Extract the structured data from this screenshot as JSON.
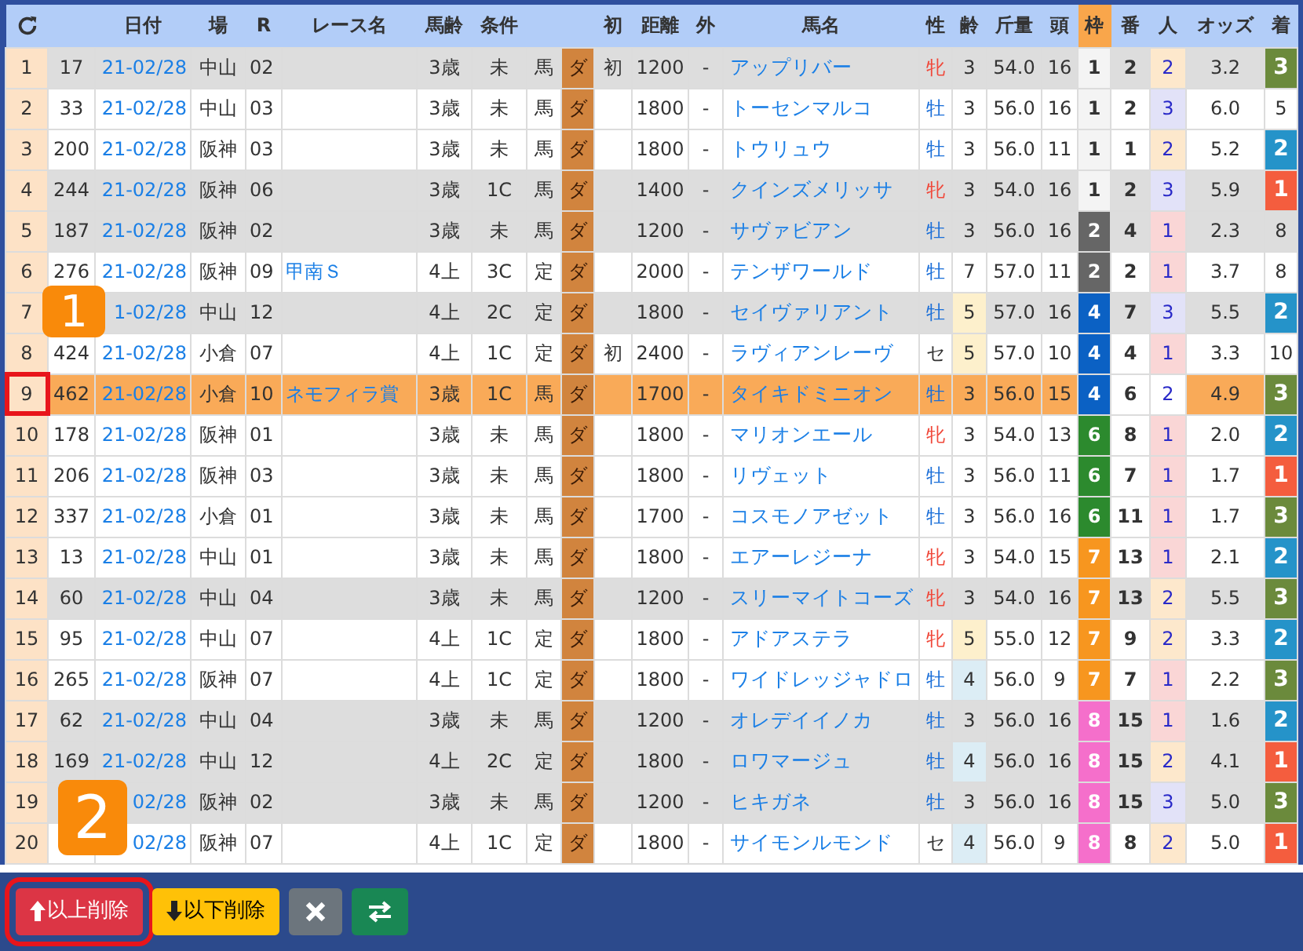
{
  "columns": [
    {
      "kind": "reload"
    },
    {},
    {
      "label": "日付"
    },
    {
      "label": "場"
    },
    {
      "label": "R"
    },
    {
      "label": "レース名"
    },
    {
      "label": "馬齢"
    },
    {
      "label": "条件"
    },
    {},
    {},
    {
      "label": "初"
    },
    {
      "label": "距離"
    },
    {
      "label": "外"
    },
    {
      "label": "馬名"
    },
    {
      "label": "性"
    },
    {
      "label": "齢"
    },
    {
      "label": "斤量"
    },
    {
      "label": "頭"
    },
    {
      "label": "枠",
      "kind": "accent"
    },
    {
      "label": "番"
    },
    {
      "label": "人"
    },
    {
      "label": "オッズ"
    },
    {
      "label": "着"
    }
  ],
  "rows": [
    {
      "index": "1",
      "number": "17",
      "date": "21-02/28",
      "course": "中山",
      "race": "02",
      "age_class": "3歳",
      "condition": "未",
      "rule": "馬",
      "surface": "ダ",
      "first": "初",
      "distance": "1200",
      "outside": "-",
      "horse": "アップリバー",
      "sex": {
        "text": "牝",
        "kind": "female"
      },
      "age": {
        "text": "3"
      },
      "weight": "54.0",
      "runners": "16",
      "waku": {
        "text": "1",
        "color": "#f4f4f4"
      },
      "umaban": "2",
      "popularity": {
        "text": "2",
        "color": "#fde8cc"
      },
      "odds": "3.2",
      "finish": {
        "text": "3",
        "color": "#6b8a3c"
      },
      "shaded": true,
      "selected": false,
      "highlighted": false
    },
    {
      "index": "2",
      "number": "33",
      "date": "21-02/28",
      "course": "中山",
      "race": "03",
      "age_class": "3歳",
      "condition": "未",
      "rule": "馬",
      "surface": "ダ",
      "distance": "1800",
      "outside": "-",
      "horse": "トーセンマルコ",
      "sex": {
        "text": "牡",
        "kind": "male"
      },
      "age": {
        "text": "3"
      },
      "weight": "56.0",
      "runners": "16",
      "waku": {
        "text": "1",
        "color": "#f4f4f4"
      },
      "umaban": "2",
      "popularity": {
        "text": "3",
        "color": "#e2e2f8"
      },
      "odds": "6.0",
      "finish": {
        "text": "5"
      },
      "shaded": false,
      "selected": false,
      "highlighted": false
    },
    {
      "index": "3",
      "number": "200",
      "date": "21-02/28",
      "course": "阪神",
      "race": "03",
      "age_class": "3歳",
      "condition": "未",
      "rule": "馬",
      "surface": "ダ",
      "distance": "1800",
      "outside": "-",
      "horse": "トウリュウ",
      "sex": {
        "text": "牡",
        "kind": "male"
      },
      "age": {
        "text": "3"
      },
      "weight": "56.0",
      "runners": "11",
      "waku": {
        "text": "1",
        "color": "#f4f4f4"
      },
      "umaban": "1",
      "popularity": {
        "text": "2",
        "color": "#fde8cc"
      },
      "odds": "5.2",
      "finish": {
        "text": "2",
        "color": "#2593c9"
      },
      "shaded": false,
      "selected": false,
      "highlighted": false
    },
    {
      "index": "4",
      "number": "244",
      "date": "21-02/28",
      "course": "阪神",
      "race": "06",
      "age_class": "3歳",
      "condition": "1C",
      "rule": "馬",
      "surface": "ダ",
      "distance": "1400",
      "outside": "-",
      "horse": "クインズメリッサ",
      "sex": {
        "text": "牝",
        "kind": "female"
      },
      "age": {
        "text": "3"
      },
      "weight": "54.0",
      "runners": "16",
      "waku": {
        "text": "1",
        "color": "#f4f4f4"
      },
      "umaban": "2",
      "popularity": {
        "text": "3",
        "color": "#e2e2f8"
      },
      "odds": "5.9",
      "finish": {
        "text": "1",
        "color": "#f45d3e"
      },
      "shaded": true,
      "selected": false,
      "highlighted": false
    },
    {
      "index": "5",
      "number": "187",
      "date": "21-02/28",
      "course": "阪神",
      "race": "02",
      "age_class": "3歳",
      "condition": "未",
      "rule": "馬",
      "surface": "ダ",
      "distance": "1200",
      "outside": "-",
      "horse": "サヴァビアン",
      "sex": {
        "text": "牡",
        "kind": "male"
      },
      "age": {
        "text": "3"
      },
      "weight": "56.0",
      "runners": "16",
      "waku": {
        "text": "2",
        "color": "#666666"
      },
      "umaban": "4",
      "popularity": {
        "text": "1",
        "color": "#fad6d6"
      },
      "odds": "2.3",
      "finish": {
        "text": "8"
      },
      "shaded": true,
      "selected": false,
      "highlighted": false
    },
    {
      "index": "6",
      "number": "276",
      "date": "21-02/28",
      "course": "阪神",
      "race": "09",
      "race_name": "甲南Ｓ",
      "age_class": "4上",
      "condition": "3C",
      "rule": "定",
      "surface": "ダ",
      "distance": "2000",
      "outside": "-",
      "horse": "テンザワールド",
      "sex": {
        "text": "牡",
        "kind": "male"
      },
      "age": {
        "text": "7"
      },
      "weight": "57.0",
      "runners": "11",
      "waku": {
        "text": "2",
        "color": "#666666"
      },
      "umaban": "2",
      "popularity": {
        "text": "1",
        "color": "#fad6d6"
      },
      "odds": "3.7",
      "finish": {
        "text": "8"
      },
      "shaded": false,
      "selected": false,
      "highlighted": false
    },
    {
      "index": "7",
      "date": "1-02/28",
      "course": "中山",
      "race": "12",
      "age_class": "4上",
      "condition": "2C",
      "rule": "定",
      "surface": "ダ",
      "distance": "1800",
      "outside": "-",
      "horse": "セイヴァリアント",
      "sex": {
        "text": "牡",
        "kind": "male"
      },
      "age": {
        "text": "5",
        "color": "#fdf0cc"
      },
      "weight": "57.0",
      "runners": "16",
      "waku": {
        "text": "4",
        "color": "#0b61c4"
      },
      "umaban": "7",
      "popularity": {
        "text": "3",
        "color": "#e2e2f8"
      },
      "odds": "5.5",
      "finish": {
        "text": "2",
        "color": "#2593c9"
      },
      "shaded": true,
      "selected": false,
      "highlighted": false
    },
    {
      "index": "8",
      "number": "424",
      "date": "21-02/28",
      "course": "小倉",
      "race": "07",
      "age_class": "4上",
      "condition": "1C",
      "rule": "定",
      "surface": "ダ",
      "first": "初",
      "distance": "2400",
      "outside": "-",
      "horse": "ラヴィアンレーヴ",
      "sex": {
        "text": "セ",
        "kind": "gelding"
      },
      "age": {
        "text": "5",
        "color": "#fdf0cc"
      },
      "weight": "57.0",
      "runners": "10",
      "waku": {
        "text": "4",
        "color": "#0b61c4"
      },
      "umaban": "4",
      "popularity": {
        "text": "1",
        "color": "#fad6d6"
      },
      "odds": "3.3",
      "finish": {
        "text": "10"
      },
      "shaded": false,
      "selected": false,
      "highlighted": false
    },
    {
      "index": "9",
      "number": "462",
      "date": "21-02/28",
      "course": "小倉",
      "race": "10",
      "race_name": "ネモフィラ賞",
      "age_class": "3歳",
      "condition": "1C",
      "rule": "馬",
      "surface": "ダ",
      "distance": "1700",
      "outside": "-",
      "horse": "タイキドミニオン",
      "sex": {
        "text": "牡",
        "kind": "male"
      },
      "age": {
        "text": "3"
      },
      "weight": "56.0",
      "runners": "15",
      "waku": {
        "text": "4",
        "color": "#0b61c4"
      },
      "umaban": "6",
      "popularity": {
        "text": "2"
      },
      "odds": "4.9",
      "finish": {
        "text": "3",
        "color": "#6b8a3c"
      },
      "selected": true,
      "highlighted": true
    },
    {
      "index": "10",
      "number": "178",
      "date": "21-02/28",
      "course": "阪神",
      "race": "01",
      "age_class": "3歳",
      "condition": "未",
      "rule": "馬",
      "surface": "ダ",
      "distance": "1800",
      "outside": "-",
      "horse": "マリオンエール",
      "sex": {
        "text": "牝",
        "kind": "female"
      },
      "age": {
        "text": "3"
      },
      "weight": "54.0",
      "runners": "13",
      "waku": {
        "text": "6",
        "color": "#2c8a2e"
      },
      "umaban": "8",
      "popularity": {
        "text": "1",
        "color": "#fad6d6"
      },
      "odds": "2.0",
      "finish": {
        "text": "2",
        "color": "#2593c9"
      },
      "shaded": false,
      "selected": false,
      "highlighted": false
    },
    {
      "index": "11",
      "number": "206",
      "date": "21-02/28",
      "course": "阪神",
      "race": "03",
      "age_class": "3歳",
      "condition": "未",
      "rule": "馬",
      "surface": "ダ",
      "distance": "1800",
      "outside": "-",
      "horse": "リヴェット",
      "sex": {
        "text": "牡",
        "kind": "male"
      },
      "age": {
        "text": "3"
      },
      "weight": "56.0",
      "runners": "11",
      "waku": {
        "text": "6",
        "color": "#2c8a2e"
      },
      "umaban": "7",
      "popularity": {
        "text": "1",
        "color": "#fad6d6"
      },
      "odds": "1.7",
      "finish": {
        "text": "1",
        "color": "#f45d3e"
      },
      "shaded": false,
      "selected": false,
      "highlighted": false
    },
    {
      "index": "12",
      "number": "337",
      "date": "21-02/28",
      "course": "小倉",
      "race": "01",
      "age_class": "3歳",
      "condition": "未",
      "rule": "馬",
      "surface": "ダ",
      "distance": "1700",
      "outside": "-",
      "horse": "コスモノアゼット",
      "sex": {
        "text": "牡",
        "kind": "male"
      },
      "age": {
        "text": "3"
      },
      "weight": "56.0",
      "runners": "16",
      "waku": {
        "text": "6",
        "color": "#2c8a2e"
      },
      "umaban": "11",
      "popularity": {
        "text": "1",
        "color": "#fad6d6"
      },
      "odds": "1.7",
      "finish": {
        "text": "3",
        "color": "#6b8a3c"
      },
      "shaded": false,
      "selected": false,
      "highlighted": false
    },
    {
      "index": "13",
      "number": "13",
      "date": "21-02/28",
      "course": "中山",
      "race": "01",
      "age_class": "3歳",
      "condition": "未",
      "rule": "馬",
      "surface": "ダ",
      "distance": "1800",
      "outside": "-",
      "horse": "エアーレジーナ",
      "sex": {
        "text": "牝",
        "kind": "female"
      },
      "age": {
        "text": "3"
      },
      "weight": "54.0",
      "runners": "15",
      "waku": {
        "text": "7",
        "color": "#f7961f"
      },
      "umaban": "13",
      "popularity": {
        "text": "1",
        "color": "#fad6d6"
      },
      "odds": "2.1",
      "finish": {
        "text": "2",
        "color": "#2593c9"
      },
      "shaded": false,
      "selected": false,
      "highlighted": false
    },
    {
      "index": "14",
      "number": "60",
      "date": "21-02/28",
      "course": "中山",
      "race": "04",
      "age_class": "3歳",
      "condition": "未",
      "rule": "馬",
      "surface": "ダ",
      "distance": "1200",
      "outside": "-",
      "horse": "スリーマイトコーズ",
      "sex": {
        "text": "牝",
        "kind": "female"
      },
      "age": {
        "text": "3"
      },
      "weight": "54.0",
      "runners": "16",
      "waku": {
        "text": "7",
        "color": "#f7961f"
      },
      "umaban": "13",
      "popularity": {
        "text": "2",
        "color": "#fde8cc"
      },
      "odds": "5.5",
      "finish": {
        "text": "3",
        "color": "#6b8a3c"
      },
      "shaded": true,
      "selected": false,
      "highlighted": false
    },
    {
      "index": "15",
      "number": "95",
      "date": "21-02/28",
      "course": "中山",
      "race": "07",
      "age_class": "4上",
      "condition": "1C",
      "rule": "定",
      "surface": "ダ",
      "distance": "1800",
      "outside": "-",
      "horse": "アドアステラ",
      "sex": {
        "text": "牝",
        "kind": "female"
      },
      "age": {
        "text": "5",
        "color": "#fdf0cc"
      },
      "weight": "55.0",
      "runners": "12",
      "waku": {
        "text": "7",
        "color": "#f7961f"
      },
      "umaban": "9",
      "popularity": {
        "text": "2",
        "color": "#fde8cc"
      },
      "odds": "3.3",
      "finish": {
        "text": "2",
        "color": "#2593c9"
      },
      "shaded": false,
      "selected": false,
      "highlighted": false
    },
    {
      "index": "16",
      "number": "265",
      "date": "21-02/28",
      "course": "阪神",
      "race": "07",
      "age_class": "4上",
      "condition": "1C",
      "rule": "定",
      "surface": "ダ",
      "distance": "1800",
      "outside": "-",
      "horse": "ワイドレッジャドロ",
      "sex": {
        "text": "牡",
        "kind": "male"
      },
      "age": {
        "text": "4",
        "color": "#dcedf5"
      },
      "weight": "56.0",
      "runners": "9",
      "waku": {
        "text": "7",
        "color": "#f7961f"
      },
      "umaban": "7",
      "popularity": {
        "text": "1",
        "color": "#fad6d6"
      },
      "odds": "2.2",
      "finish": {
        "text": "3",
        "color": "#6b8a3c"
      },
      "shaded": false,
      "selected": false,
      "highlighted": false
    },
    {
      "index": "17",
      "number": "62",
      "date": "21-02/28",
      "course": "中山",
      "race": "04",
      "age_class": "3歳",
      "condition": "未",
      "rule": "馬",
      "surface": "ダ",
      "distance": "1200",
      "outside": "-",
      "horse": "オレデイイノカ",
      "sex": {
        "text": "牡",
        "kind": "male"
      },
      "age": {
        "text": "3"
      },
      "weight": "56.0",
      "runners": "16",
      "waku": {
        "text": "8",
        "color": "#f56fcb"
      },
      "umaban": "15",
      "popularity": {
        "text": "1",
        "color": "#fad6d6"
      },
      "odds": "1.6",
      "finish": {
        "text": "2",
        "color": "#2593c9"
      },
      "shaded": true,
      "selected": false,
      "highlighted": false
    },
    {
      "index": "18",
      "number": "169",
      "date": "21-02/28",
      "course": "中山",
      "race": "12",
      "age_class": "4上",
      "condition": "2C",
      "rule": "定",
      "surface": "ダ",
      "distance": "1800",
      "outside": "-",
      "horse": "ロワマージュ",
      "sex": {
        "text": "牡",
        "kind": "male"
      },
      "age": {
        "text": "4",
        "color": "#dcedf5"
      },
      "weight": "56.0",
      "runners": "16",
      "waku": {
        "text": "8",
        "color": "#f56fcb"
      },
      "umaban": "15",
      "popularity": {
        "text": "2",
        "color": "#fde8cc"
      },
      "odds": "4.1",
      "finish": {
        "text": "1",
        "color": "#f45d3e"
      },
      "shaded": true,
      "selected": false,
      "highlighted": false
    },
    {
      "index": "19",
      "date": "02/28",
      "course": "阪神",
      "race": "02",
      "age_class": "3歳",
      "condition": "未",
      "rule": "馬",
      "surface": "ダ",
      "distance": "1200",
      "outside": "-",
      "horse": "ヒキガネ",
      "sex": {
        "text": "牡",
        "kind": "male"
      },
      "age": {
        "text": "3"
      },
      "weight": "56.0",
      "runners": "16",
      "waku": {
        "text": "8",
        "color": "#f56fcb"
      },
      "umaban": "15",
      "popularity": {
        "text": "3",
        "color": "#e2e2f8"
      },
      "odds": "5.0",
      "finish": {
        "text": "3",
        "color": "#6b8a3c"
      },
      "shaded": true,
      "selected": false,
      "highlighted": false
    },
    {
      "index": "20",
      "date": "02/28",
      "course": "阪神",
      "race": "07",
      "age_class": "4上",
      "condition": "1C",
      "rule": "定",
      "surface": "ダ",
      "distance": "1800",
      "outside": "-",
      "horse": "サイモンルモンド",
      "sex": {
        "text": "セ",
        "kind": "gelding"
      },
      "age": {
        "text": "4",
        "color": "#dcedf5"
      },
      "weight": "56.0",
      "runners": "9",
      "waku": {
        "text": "8",
        "color": "#f56fcb"
      },
      "umaban": "8",
      "popularity": {
        "text": "2",
        "color": "#fde8cc"
      },
      "odds": "5.0",
      "finish": {
        "text": "1",
        "color": "#f45d3e"
      },
      "shaded": false,
      "selected": false,
      "highlighted": false
    }
  ],
  "buttons": [
    {
      "kind": "delete_above",
      "label": "以上削除",
      "highlighted": true
    },
    {
      "kind": "delete_below",
      "label": "以下削除",
      "highlighted": false
    },
    {
      "kind": "clear",
      "highlighted": false
    },
    {
      "kind": "swap",
      "highlighted": false
    }
  ],
  "annotations": [
    {
      "label": "1"
    },
    {
      "label": "2"
    }
  ]
}
